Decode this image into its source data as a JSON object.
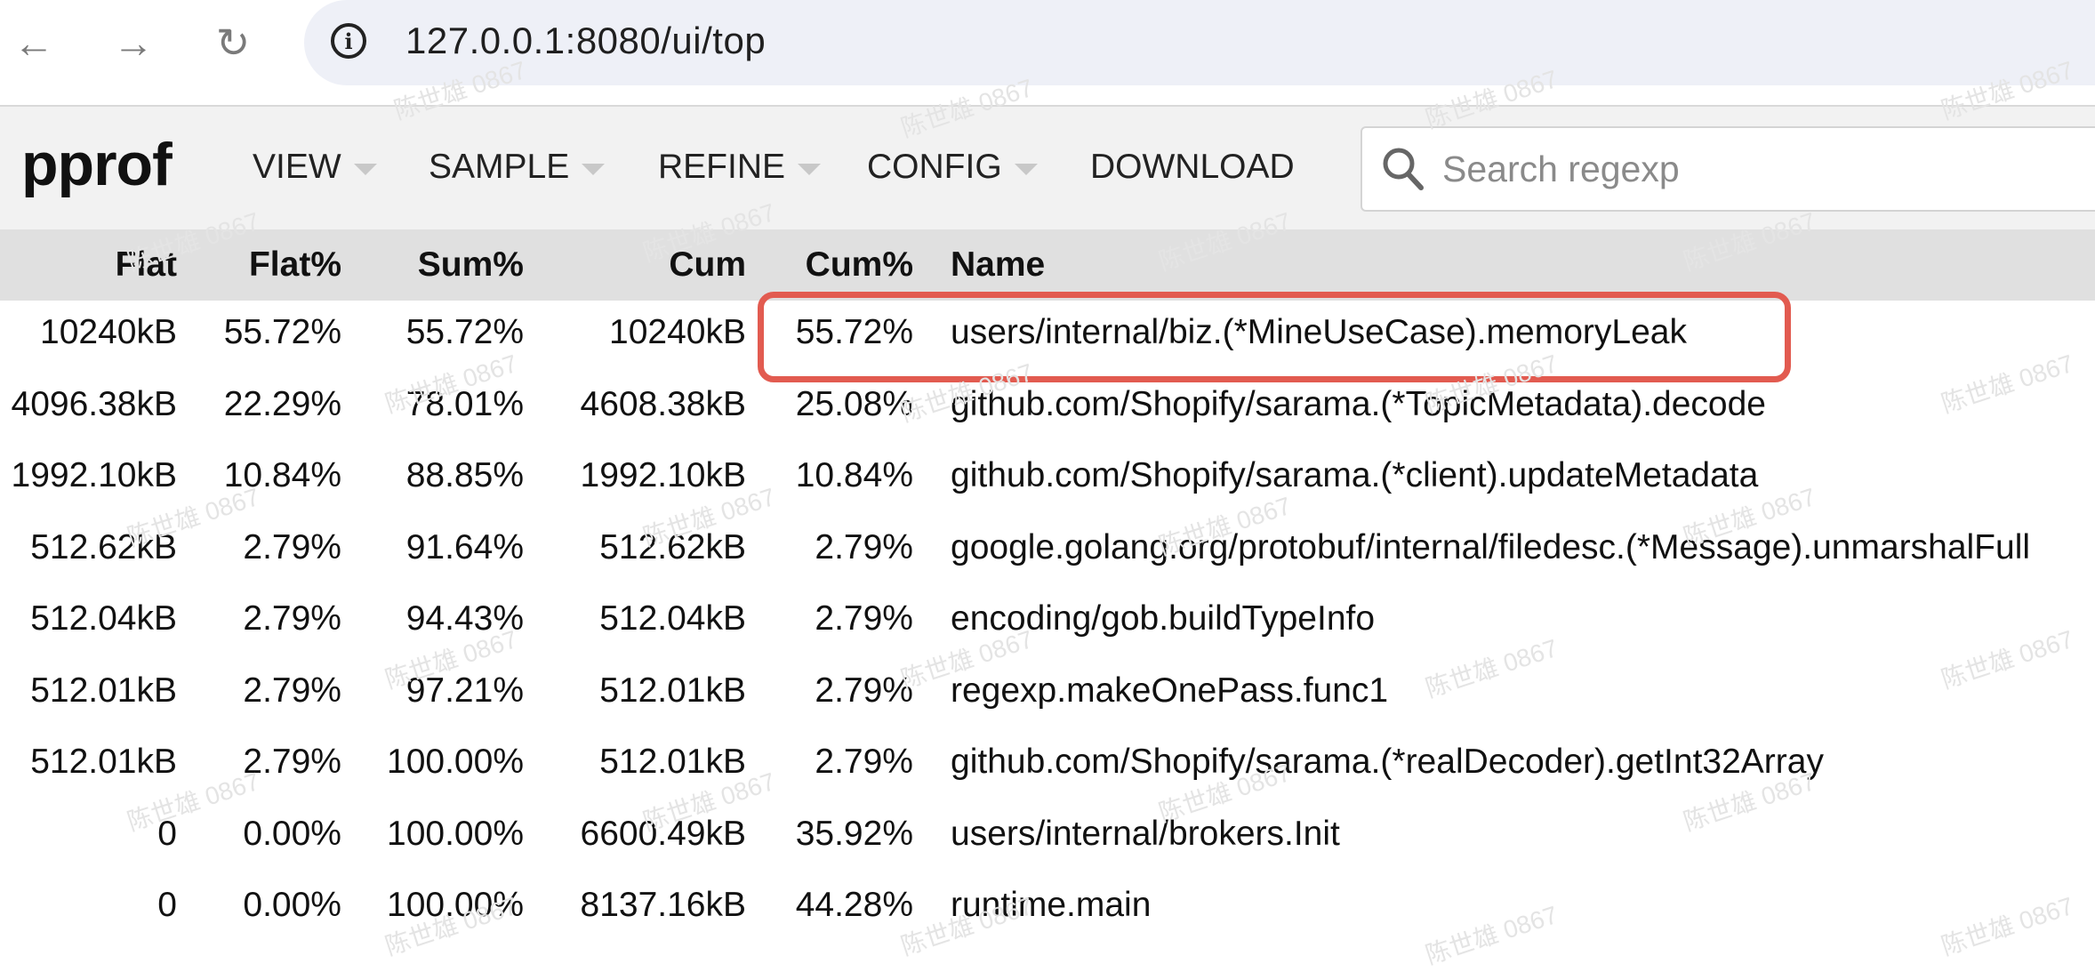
{
  "browser": {
    "url": "127.0.0.1:8080/ui/top",
    "back_glyph": "←",
    "forward_glyph": "→",
    "reload_glyph": "↻",
    "info_glyph": "i"
  },
  "header": {
    "logo": "pprof",
    "menus": [
      {
        "label": "VIEW",
        "has_caret": true
      },
      {
        "label": "SAMPLE",
        "has_caret": true
      },
      {
        "label": "REFINE",
        "has_caret": true
      },
      {
        "label": "CONFIG",
        "has_caret": true
      },
      {
        "label": "DOWNLOAD",
        "has_caret": false
      }
    ],
    "search_placeholder": "Search regexp"
  },
  "table": {
    "columns": [
      "Flat",
      "Flat%",
      "Sum%",
      "Cum",
      "Cum%",
      "Name"
    ],
    "rows": [
      [
        "10240kB",
        "55.72%",
        "55.72%",
        "10240kB",
        "55.72%",
        "users/internal/biz.(*MineUseCase).memoryLeak"
      ],
      [
        "4096.38kB",
        "22.29%",
        "78.01%",
        "4608.38kB",
        "25.08%",
        "github.com/Shopify/sarama.(*TopicMetadata).decode"
      ],
      [
        "1992.10kB",
        "10.84%",
        "88.85%",
        "1992.10kB",
        "10.84%",
        "github.com/Shopify/sarama.(*client).updateMetadata"
      ],
      [
        "512.62kB",
        "2.79%",
        "91.64%",
        "512.62kB",
        "2.79%",
        "google.golang.org/protobuf/internal/filedesc.(*Message).unmarshalFull"
      ],
      [
        "512.04kB",
        "2.79%",
        "94.43%",
        "512.04kB",
        "2.79%",
        "encoding/gob.buildTypeInfo"
      ],
      [
        "512.01kB",
        "2.79%",
        "97.21%",
        "512.01kB",
        "2.79%",
        "regexp.makeOnePass.func1"
      ],
      [
        "512.01kB",
        "2.79%",
        "100.00%",
        "512.01kB",
        "2.79%",
        "github.com/Shopify/sarama.(*realDecoder).getInt32Array"
      ],
      [
        "0",
        "0.00%",
        "100.00%",
        "6600.49kB",
        "35.92%",
        "users/internal/brokers.Init"
      ],
      [
        "0",
        "0.00%",
        "100.00%",
        "8137.16kB",
        "44.28%",
        "runtime.main"
      ]
    ],
    "highlighted_row": 0
  },
  "watermark": "陈世雄 0867",
  "colors": {
    "highlight": "#e25b50",
    "header_bg": "#f2f2f2",
    "table_header_bg": "#e0e0e0",
    "url_bar_bg": "#eef0f7"
  }
}
